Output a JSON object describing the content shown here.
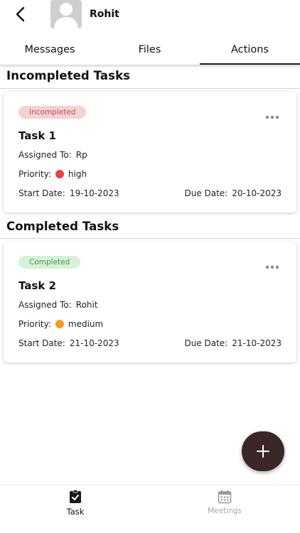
{
  "header": {
    "contact_name": "Rohit"
  },
  "tabs": [
    {
      "label": "Messages",
      "active": false
    },
    {
      "label": "Files",
      "active": false
    },
    {
      "label": "Actions",
      "active": true
    }
  ],
  "sections": {
    "incompleted_title": "Incompleted Tasks",
    "completed_title": "Completed Tasks"
  },
  "tasks": [
    {
      "status": "Incompleted",
      "title": "Task 1",
      "assigned_label": "Assigned To:",
      "assigned_to": "Rp",
      "priority_label": "Priority:",
      "priority": "high",
      "priority_color": "#e9423f",
      "start_label": "Start Date:",
      "start_date": "19-10-2023",
      "due_label": "Due Date:",
      "due_date": "20-10-2023"
    },
    {
      "status": "Completed",
      "title": "Task 2",
      "assigned_label": "Assigned To:",
      "assigned_to": "Rohit",
      "priority_label": "Priority:",
      "priority": "medium",
      "priority_color": "#f39c1a",
      "start_label": "Start Date:",
      "start_date": "21-10-2023",
      "due_label": "Due Date:",
      "due_date": "21-10-2023"
    }
  ],
  "fab": {
    "icon": "plus-icon"
  },
  "bottom_nav": [
    {
      "label": "Task",
      "icon": "task-checklist-icon",
      "active": true
    },
    {
      "label": "Meetings",
      "icon": "calendar-icon",
      "active": false
    }
  ],
  "colors": {
    "accent": "#3b2727",
    "incomplete_badge_bg": "#f2d2d3",
    "incomplete_badge_text": "#d04a4d",
    "complete_badge_bg": "#d6f2d9",
    "complete_badge_text": "#3f9a4d"
  }
}
